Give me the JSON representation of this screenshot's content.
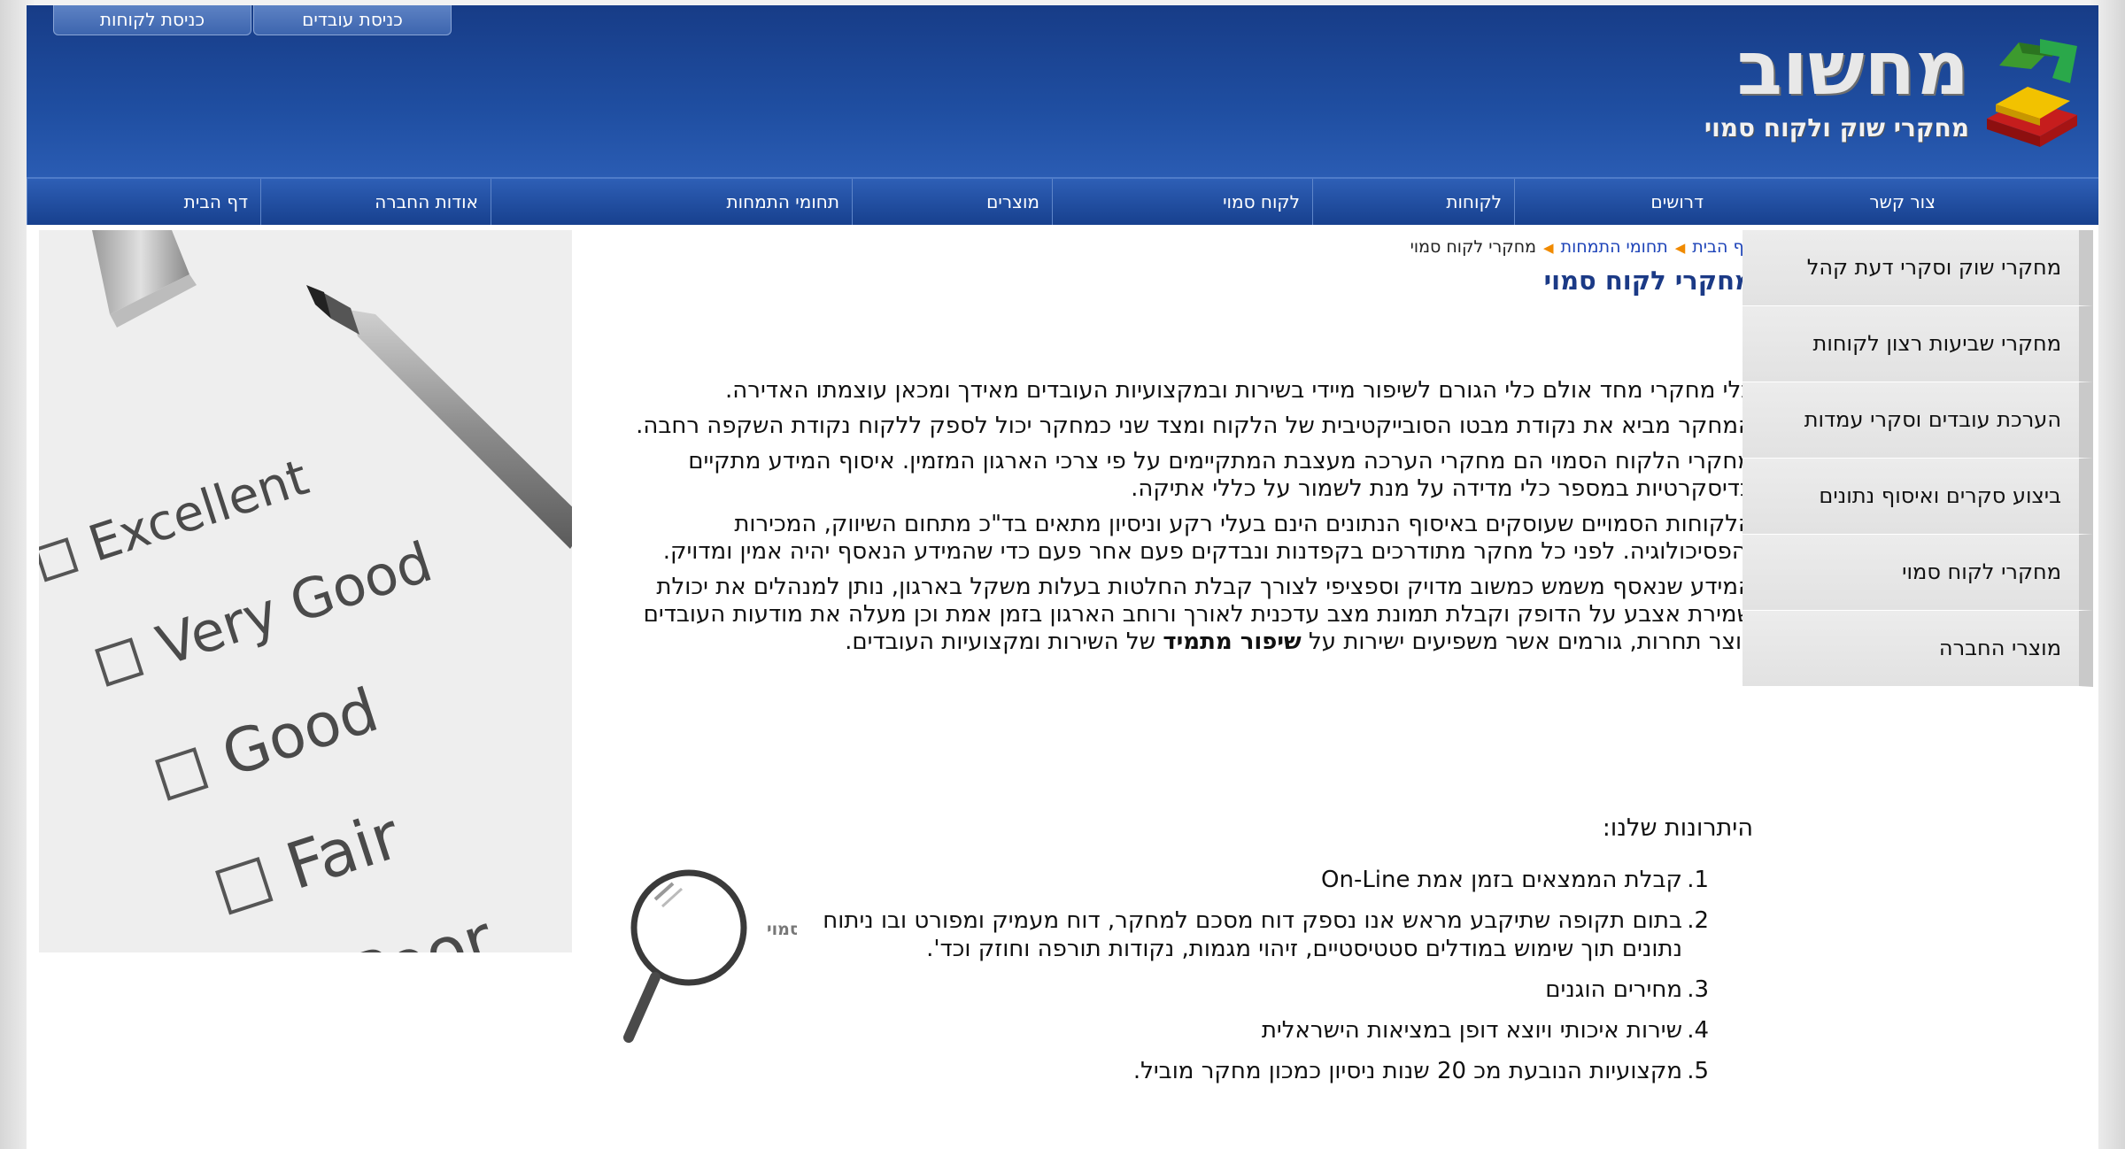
{
  "header": {
    "top_links": [
      "כניסת לקוחות",
      "כניסת עובדים"
    ],
    "logo_text": "מחשוב",
    "logo_subtitle": "מחקרי שוק ולקוח סמוי"
  },
  "nav": {
    "items": [
      "דף הבית",
      "אודות החברה",
      "תחומי התמחות",
      "מוצרים",
      "לקוח סמוי",
      "לקוחות",
      "דרושים",
      "צור קשר"
    ]
  },
  "sidebar": {
    "items": [
      "מחקרי שוק וסקרי דעת קהל",
      "מחקרי שביעות רצון לקוחות",
      "הערכת עובדים וסקרי עמדות",
      "ביצוע סקרים ואיסוף נתונים",
      "מחקרי לקוח סמוי",
      "מוצרי החברה"
    ]
  },
  "breadcrumb": {
    "home": "דף הבית",
    "section": "תחומי התמחות",
    "current": "מחקרי לקוח סמוי"
  },
  "content": {
    "title": "מחקרי לקוח סמוי",
    "paragraphs": [
      "כלי מחקרי מחד אולם כלי הגורם לשיפור מיידי בשירות ובמקצועיות העובדים מאידך ומכאן עוצמתו האדירה.",
      "המחקר מביא את נקודת מבטו הסובייקטיבית של הלקוח ומצד שני כמחקר יכול לספק ללקוח נקודת השקפה רחבה.",
      "מחקרי הלקוח הסמוי הם מחקרי הערכה מעצבת המתקיימים על פי צרכי הארגון המזמין. איסוף המידע מתקיים בדיסקרטיות במספר כלי מדידה על מנת לשמור על  כללי אתיקה.",
      "הלקוחות הסמויים שעוסקים באיסוף הנתונים הינם בעלי רקע וניסיון מתאים בד\"כ מתחום השיווק, המכירות והפסיכולוגיה. לפני כל מחקר מתודרכים בקפדנות ונבדקים פעם אחר פעם כדי שהמידע הנאסף יהיה אמין ומדויק."
    ],
    "last_paragraph_before": "המידע שנאסף משמש כמשוב מדויק וספציפי לצורך קבלת החלטות בעלות משקל בארגון, נותן למנהלים את יכולת שמירת אצבע על הדופק וקבלת תמונת מצב עדכנית לאורך ורוחב הארגון בזמן אמת וכן מעלה את מודעות העובדים ויוצר תחרות, גורמים אשר משפיעים ישירות על ",
    "last_paragraph_bold": "שיפור מתמיד",
    "last_paragraph_after": " של השירות ומקצועיות העובדים.",
    "advantages_title": "היתרונות שלנו:",
    "advantages": [
      {
        "num": "1.",
        "text": "קבלת הממצאים בזמן אמת On-Line"
      },
      {
        "num": "2.",
        "text": "בתום תקופה שתיקבע מראש אנו נספק דוח מסכם למחקר, דוח מעמיק ומפורט ובו ניתוח נתונים תוך שימוש במודלים סטטיסטיים, זיהוי מגמות, נקודות תורפה וחוזק וכד'."
      },
      {
        "num": "3.",
        "text": "מחירים הוגנים"
      },
      {
        "num": "4.",
        "text": "שירות איכותי ויוצא דופן במציאות הישראלית"
      },
      {
        "num": "5.",
        "text": "מקצועיות הנובעת מכ 20 שנות ניסיון כמכון מחקר מוביל."
      }
    ],
    "magnifier_label": "לקוח סמוי"
  },
  "photo": {
    "options": [
      "Excellent",
      "Very Good",
      "Good",
      "Fair",
      "Poor"
    ]
  }
}
